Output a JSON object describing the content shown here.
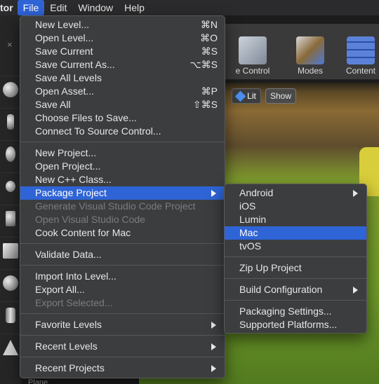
{
  "menubar": {
    "app": "tor",
    "items": [
      "File",
      "Edit",
      "Window",
      "Help"
    ]
  },
  "editor": {
    "tab_close": "×",
    "toolbar": {
      "source_control": "e Control",
      "modes": "Modes",
      "content": "Content"
    },
    "viewport": {
      "lit": "Lit",
      "show": "Show"
    },
    "bottom_label": "Plane"
  },
  "file_menu": {
    "group1": [
      {
        "label": "New Level...",
        "shortcut": "⌘N"
      },
      {
        "label": "Open Level...",
        "shortcut": "⌘O"
      },
      {
        "label": "Save Current",
        "shortcut": "⌘S"
      },
      {
        "label": "Save Current As...",
        "shortcut": "⌥⌘S"
      },
      {
        "label": "Save All Levels",
        "shortcut": ""
      },
      {
        "label": "Open Asset...",
        "shortcut": "⌘P"
      },
      {
        "label": "Save All",
        "shortcut": "⇧⌘S"
      },
      {
        "label": "Choose Files to Save...",
        "shortcut": ""
      },
      {
        "label": "Connect To Source Control...",
        "shortcut": ""
      }
    ],
    "group2": [
      {
        "label": "New Project..."
      },
      {
        "label": "Open Project..."
      },
      {
        "label": "New C++ Class..."
      },
      {
        "label": "Package Project"
      },
      {
        "label": "Generate Visual Studio Code Project"
      },
      {
        "label": "Open Visual Studio Code"
      },
      {
        "label": "Cook Content for Mac"
      }
    ],
    "group3": [
      {
        "label": "Validate Data..."
      }
    ],
    "group4": [
      {
        "label": "Import Into Level..."
      },
      {
        "label": "Export All..."
      },
      {
        "label": "Export Selected..."
      }
    ],
    "favorite_levels": "Favorite Levels",
    "recent_levels": "Recent Levels",
    "recent_projects": "Recent Projects"
  },
  "package_submenu": {
    "platforms": [
      "Android",
      "iOS",
      "Lumin",
      "Mac",
      "tvOS"
    ],
    "zip_up": "Zip Up Project",
    "build_configuration": "Build Configuration",
    "packaging_settings": "Packaging Settings...",
    "supported_platforms": "Supported Platforms..."
  },
  "colors": {
    "highlight": "#2f64d6",
    "menu_bg": "#3b3d3f",
    "disabled_text": "#7c7c7c"
  }
}
